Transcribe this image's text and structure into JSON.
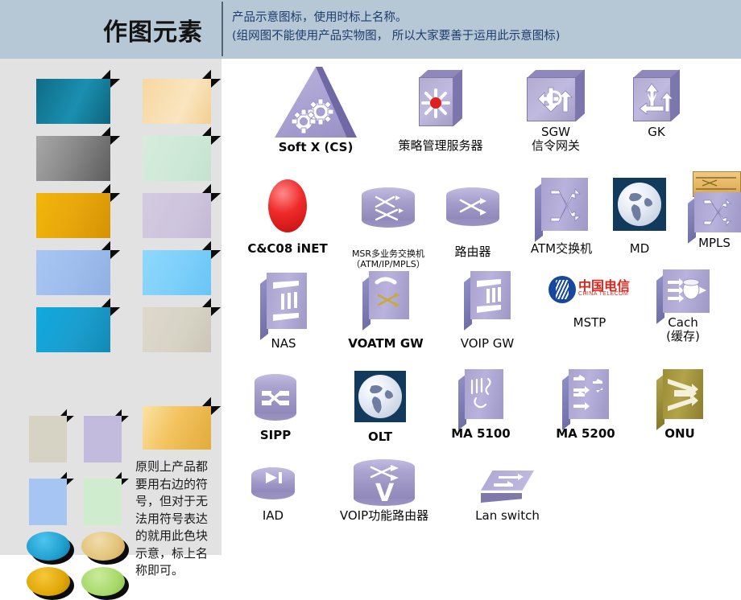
{
  "header": {
    "title": "作图元素",
    "subtitle_line1": "产品示意图标，使用时标上名称。",
    "subtitle_line2": "(组网图不能使用产品实物图， 所以大家要善于运用此示意图标)",
    "title_color": "#141414",
    "subtitle_color": "#1f3c6e",
    "background_color": "#b6c8d6"
  },
  "sidebar": {
    "background_color": "#e2e2e2",
    "note": "原则上产品都要用右边的符号，但对于无法用符号表达的就用此色块示意，标上名称即可。",
    "swatches": [
      {
        "name": "swatch-teal-box",
        "shape": "box",
        "color": "#157f9e"
      },
      {
        "name": "swatch-peach-box",
        "shape": "box",
        "color": "#f7ddab"
      },
      {
        "name": "swatch-gray-box",
        "shape": "box",
        "color": "#8d8d8d"
      },
      {
        "name": "swatch-mint-box",
        "shape": "box",
        "color": "#cfe9d8"
      },
      {
        "name": "swatch-gold-box",
        "shape": "box",
        "color": "#e8a70c"
      },
      {
        "name": "swatch-lilac-box",
        "shape": "box",
        "color": "#cdc4dd"
      },
      {
        "name": "swatch-cornflower-box",
        "shape": "box",
        "color": "#9dbcec"
      },
      {
        "name": "swatch-skyblue-box",
        "shape": "box",
        "color": "#81d2fb"
      },
      {
        "name": "swatch-cyan-box",
        "shape": "box",
        "color": "#16a3d8"
      },
      {
        "name": "swatch-sand-box",
        "shape": "box",
        "color": "#d6d2c4"
      },
      {
        "name": "swatch-sand-card",
        "shape": "card",
        "color": "#d6d2c4"
      },
      {
        "name": "swatch-lavender-card",
        "shape": "card",
        "color": "#c3bbdd"
      },
      {
        "name": "swatch-amber-box",
        "shape": "box",
        "color": "#f3c35f"
      },
      {
        "name": "swatch-blue-card",
        "shape": "card",
        "color": "#a6c5f3"
      },
      {
        "name": "swatch-palegreen-card",
        "shape": "card",
        "color": "#cfeccf"
      },
      {
        "name": "swatch-blue-ellipse",
        "shape": "ellipse",
        "color": "#1f9fd0"
      },
      {
        "name": "swatch-tan-ellipse",
        "shape": "ellipse",
        "color": "#e3c378"
      },
      {
        "name": "swatch-orange-ellipse",
        "shape": "ellipse",
        "color": "#e0a707"
      },
      {
        "name": "swatch-green-ellipse",
        "shape": "ellipse",
        "color": "#a7d96a"
      }
    ]
  },
  "main": {
    "icons": [
      {
        "id": "soft-x-cs",
        "label": "Soft X (CS)",
        "label2": "",
        "bold": true
      },
      {
        "id": "policy-management-server",
        "label": "策略管理服务器",
        "label2": "",
        "bold": false
      },
      {
        "id": "sgw",
        "label": "SGW",
        "label2": "信令网关",
        "bold": false
      },
      {
        "id": "gk",
        "label": "GK",
        "label2": "",
        "bold": false
      },
      {
        "id": "cc08-inet",
        "label": "C&C08 iNET",
        "label2": "",
        "bold": true
      },
      {
        "id": "msr-multiservice-switch",
        "label": "MSR多业务交换机",
        "label2": "（ATM/IP/MPLS）",
        "bold": false
      },
      {
        "id": "router",
        "label": "路由器",
        "label2": "",
        "bold": false
      },
      {
        "id": "atm-switch",
        "label": "ATM交换机",
        "label2": "",
        "bold": false
      },
      {
        "id": "md",
        "label": "MD",
        "label2": "",
        "bold": false
      },
      {
        "id": "mpls",
        "label": "MPLS",
        "label2": "",
        "bold": false
      },
      {
        "id": "nas",
        "label": "NAS",
        "label2": "",
        "bold": false
      },
      {
        "id": "voatm-gw",
        "label": "VOATM GW",
        "label2": "",
        "bold": true
      },
      {
        "id": "voip-gw",
        "label": "VOIP GW",
        "label2": "",
        "bold": false
      },
      {
        "id": "mstp",
        "label": "MSTP",
        "label2": "",
        "bold": false
      },
      {
        "id": "cach",
        "label": "Cach",
        "label2": "(缓存)",
        "bold": false
      },
      {
        "id": "sipp",
        "label": "SIPP",
        "label2": "",
        "bold": true
      },
      {
        "id": "olt",
        "label": "OLT",
        "label2": "",
        "bold": true
      },
      {
        "id": "ma-5100",
        "label": "MA 5100",
        "label2": "",
        "bold": true
      },
      {
        "id": "ma-5200",
        "label": "MA 5200",
        "label2": "",
        "bold": true
      },
      {
        "id": "onu",
        "label": "ONU",
        "label2": "",
        "bold": true
      },
      {
        "id": "iad",
        "label": "IAD",
        "label2": "",
        "bold": false
      },
      {
        "id": "voip-router",
        "label": "VOIP功能路由器",
        "label2": "",
        "bold": false
      },
      {
        "id": "lan-switch",
        "label": "Lan switch",
        "label2": "",
        "bold": false
      }
    ],
    "mstp_logo": {
      "cn": "中国电信",
      "en": "CHINA TELECOM"
    }
  }
}
